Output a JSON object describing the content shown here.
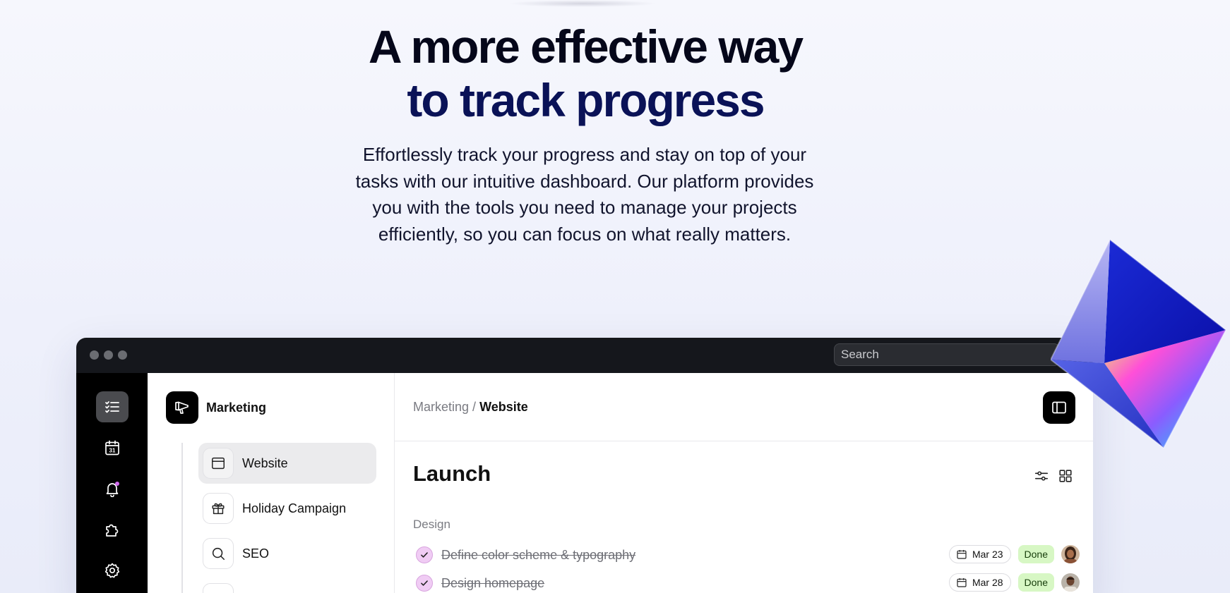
{
  "hero": {
    "title_line1": "A more effective way",
    "title_line2": "to track progress",
    "description": "Effortlessly track your progress and stay on top of your tasks with our intuitive dashboard. Our platform provides you with the tools you need to manage your projects efficiently, so you can focus on what really matters."
  },
  "window": {
    "search_placeholder": "Search"
  },
  "rail": {
    "items": [
      {
        "icon": "checklist-icon",
        "active": true
      },
      {
        "icon": "calendar-icon",
        "label": "31"
      },
      {
        "icon": "bell-icon",
        "has_notification": true
      },
      {
        "icon": "puzzle-icon"
      },
      {
        "icon": "gear-icon"
      }
    ]
  },
  "sidebar": {
    "project": "Marketing",
    "items": [
      {
        "label": "Website",
        "icon": "browser-window-icon",
        "active": true
      },
      {
        "label": "Holiday Campaign",
        "icon": "gift-icon"
      },
      {
        "label": "SEO",
        "icon": "search-icon"
      }
    ]
  },
  "main": {
    "breadcrumb_parent": "Marketing",
    "breadcrumb_sep": "/",
    "breadcrumb_current": "Website",
    "section_title": "Launch",
    "group_label": "Design",
    "tasks": [
      {
        "title": "Define color scheme & typography",
        "date": "Mar 23",
        "status": "Done"
      },
      {
        "title": "Design homepage",
        "date": "Mar 28",
        "status": "Done"
      }
    ]
  },
  "colors": {
    "accent_status_done": "#d7f7c4",
    "check_fill": "#f0ccf4",
    "notification_dot": "#d36bf0",
    "title_dark_blue": "#0a1257"
  }
}
